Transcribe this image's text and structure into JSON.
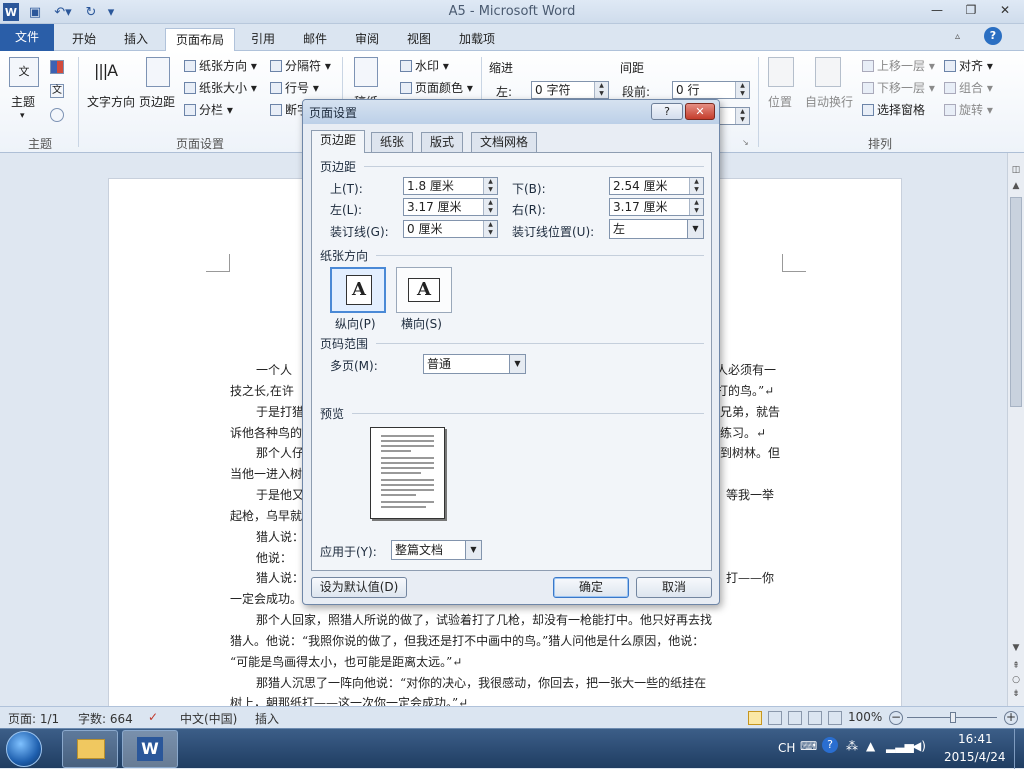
{
  "window": {
    "title": "A5 - Microsoft Word",
    "help_icon": "?"
  },
  "ribbon_tabs": [
    "文件",
    "开始",
    "插入",
    "页面布局",
    "引用",
    "邮件",
    "审阅",
    "视图",
    "加载项"
  ],
  "ribbon": {
    "theme": {
      "button": "主题",
      "group": "主题"
    },
    "page_setup": {
      "text_direction": "文字方向",
      "margins": "页边距",
      "orientation": "纸张方向",
      "size": "纸张大小",
      "columns": "分栏",
      "breaks": "分隔符",
      "line_numbers": "行号",
      "hyphenation": "断字",
      "group": "页面设置"
    },
    "page_background": {
      "watermark": "水印",
      "page_color": "页面颜色",
      "page_borders": "稿纸"
    },
    "paragraph": {
      "indent_title": "缩进",
      "indent_left_label": "左:",
      "indent_left_value": "0 字符",
      "spacing_title": "间距",
      "spacing_before_label": "段前:",
      "spacing_before_value": "0 行"
    },
    "arrange": {
      "position": "位置",
      "wrap_text": "自动换行",
      "bring_forward": "上移一层",
      "send_backward": "下移一层",
      "selection_pane": "选择窗格",
      "align": "对齐",
      "group_btn": "组合",
      "rotate": "旋转",
      "group": "排列"
    }
  },
  "document": {
    "lines": [
      "一个人",
      "技之长,在许",
      "于是打猎",
      "诉他各种鸟的",
      "那个人仔",
      "当他一进入树",
      "于是他又",
      "起枪，乌早就",
      "猎人说：",
      "他说：",
      "猎人说：",
      "一定会成功。",
      "那个人回家，照猎人所说的做了，试验着打了几枪，却没有一枪能打中。他只好再去找",
      "猎人。他说：“我照你说的做了，但我还是打不中画中的鸟。”猎人问他是什么原因，他说：",
      "“可能是鸟画得太小，也可能是距离太远。”↵",
      "那猎人沉思了一阵向他说：“对你的决心，我很感动，你回去，把一张大一些的纸挂在",
      "树上，朝那纸打——这一次你一定会成功。”↵"
    ],
    "right_fragments": [
      "人必须有一",
      "打的鸟。”↵",
      "兄弟，就告",
      "练习。↵",
      "到树林。但",
      "等我一举",
      "打——你"
    ]
  },
  "dialog": {
    "title": "页面设置",
    "help": "?",
    "close": "✕",
    "tabs": [
      "页边距",
      "纸张",
      "版式",
      "文档网格"
    ],
    "margins_section": "页边距",
    "fields": {
      "top_label": "上(T):",
      "top_value": "1.8 厘米",
      "bottom_label": "下(B):",
      "bottom_value": "2.54 厘米",
      "left_label": "左(L):",
      "left_value": "3.17 厘米",
      "right_label": "右(R):",
      "right_value": "3.17 厘米",
      "gutter_label": "装订线(G):",
      "gutter_value": "0 厘米",
      "gutter_pos_label": "装订线位置(U):",
      "gutter_pos_value": "左"
    },
    "orientation_section": "纸张方向",
    "portrait_label": "纵向(P)",
    "landscape_label": "横向(S)",
    "glyph_a": "A",
    "pages_section": "页码范围",
    "multiple_pages_label": "多页(M):",
    "multiple_pages_value": "普通",
    "preview_section": "预览",
    "apply_to_label": "应用于(Y):",
    "apply_to_value": "整篇文档",
    "set_default": "设为默认值(D)",
    "ok": "确定",
    "cancel": "取消"
  },
  "status": {
    "page": "页面: 1/1",
    "words": "字数: 664",
    "language": "中文(中国)",
    "mode": "插入",
    "zoom": "100%"
  },
  "taskbar": {
    "lang": "CH",
    "time": "16:41",
    "date": "2015/4/24"
  }
}
